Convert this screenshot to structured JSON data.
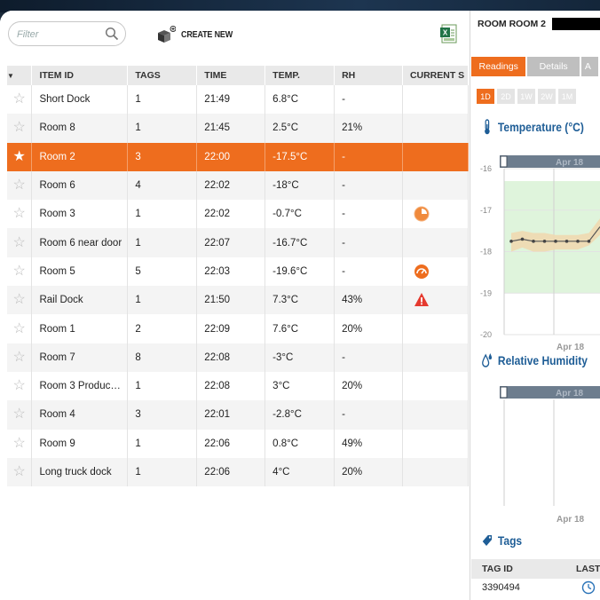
{
  "toolbar": {
    "filter_placeholder": "Filter",
    "create_new_label": "CREATE NEW"
  },
  "table": {
    "columns": [
      "ITEM ID",
      "TAGS",
      "TIME",
      "TEMP.",
      "RH",
      "CURRENT S"
    ],
    "rows": [
      {
        "id": "Short Dock",
        "tags": "1",
        "time": "21:49",
        "temp": "6.8°C",
        "rh": "-",
        "status": ""
      },
      {
        "id": "Room 8",
        "tags": "1",
        "time": "21:45",
        "temp": "2.5°C",
        "rh": "21%",
        "status": ""
      },
      {
        "id": "Room 2",
        "tags": "3",
        "time": "22:00",
        "temp": "-17.5°C",
        "rh": "-",
        "status": ""
      },
      {
        "id": "Room 6",
        "tags": "4",
        "time": "22:02",
        "temp": "-18°C",
        "rh": "-",
        "status": ""
      },
      {
        "id": "Room 3",
        "tags": "1",
        "time": "22:02",
        "temp": "-0.7°C",
        "rh": "-",
        "status": "pie-icon"
      },
      {
        "id": "Room 6 near door",
        "tags": "1",
        "time": "22:07",
        "temp": "-16.7°C",
        "rh": "-",
        "status": ""
      },
      {
        "id": "Room 5",
        "tags": "5",
        "time": "22:03",
        "temp": "-19.6°C",
        "rh": "-",
        "status": "gauge-icon"
      },
      {
        "id": "Rail Dock",
        "tags": "1",
        "time": "21:50",
        "temp": "7.3°C",
        "rh": "43%",
        "status": "warning-icon"
      },
      {
        "id": "Room 1",
        "tags": "2",
        "time": "22:09",
        "temp": "7.6°C",
        "rh": "20%",
        "status": ""
      },
      {
        "id": "Room 7",
        "tags": "8",
        "time": "22:08",
        "temp": "-3°C",
        "rh": "-",
        "status": ""
      },
      {
        "id": "Room 3 Produc…",
        "tags": "1",
        "time": "22:08",
        "temp": "3°C",
        "rh": "20%",
        "status": ""
      },
      {
        "id": "Room 4",
        "tags": "3",
        "time": "22:01",
        "temp": "-2.8°C",
        "rh": "-",
        "status": ""
      },
      {
        "id": "Room 9",
        "tags": "1",
        "time": "22:06",
        "temp": "0.8°C",
        "rh": "49%",
        "status": ""
      },
      {
        "id": "Long truck dock",
        "tags": "1",
        "time": "22:06",
        "temp": "4°C",
        "rh": "20%",
        "status": ""
      }
    ],
    "selected_index": 2
  },
  "detail": {
    "title": "ROOM ROOM 2",
    "tabs": [
      "Readings",
      "Details",
      "A"
    ],
    "ranges": [
      "1D",
      "2D",
      "1W",
      "2W",
      "1M"
    ],
    "temperature_title": "Temperature (°C)",
    "humidity_title": "Relative Humidity",
    "tags_title": "Tags",
    "tags_columns": [
      "TAG ID",
      "LAST"
    ],
    "tags_rows": [
      {
        "tag_id": "3390494"
      }
    ]
  },
  "chart_data": [
    {
      "type": "line",
      "title": "Temperature (°C)",
      "yticks": [
        -16,
        -17,
        -18,
        -19,
        -20
      ],
      "ylim": [
        -20,
        -16
      ],
      "date_label": "Apr 18",
      "x": [
        0,
        1,
        2,
        3,
        4,
        5,
        6,
        7,
        8
      ],
      "series": [
        {
          "values": [
            -17.75,
            -17.7,
            -17.75,
            -17.75,
            -17.75,
            -17.75,
            -17.75,
            -17.75,
            -17.4
          ]
        }
      ],
      "band": {
        "low": [
          -18.0,
          -17.9,
          -18.0,
          -18.0,
          -17.95,
          -17.95,
          -17.95,
          -17.85,
          -17.6
        ],
        "high": [
          -17.55,
          -17.5,
          -17.55,
          -17.55,
          -17.6,
          -17.6,
          -17.6,
          -17.55,
          -17.2
        ]
      },
      "ok_range": [
        -19,
        -16.3
      ]
    },
    {
      "type": "line",
      "title": "Relative Humidity",
      "date_label": "Apr 18",
      "series": []
    }
  ],
  "colors": {
    "accent": "#ee6d1e",
    "heading": "#1e5d96",
    "ok_zone": "#dff4dc",
    "band": "#f0d9b0"
  }
}
